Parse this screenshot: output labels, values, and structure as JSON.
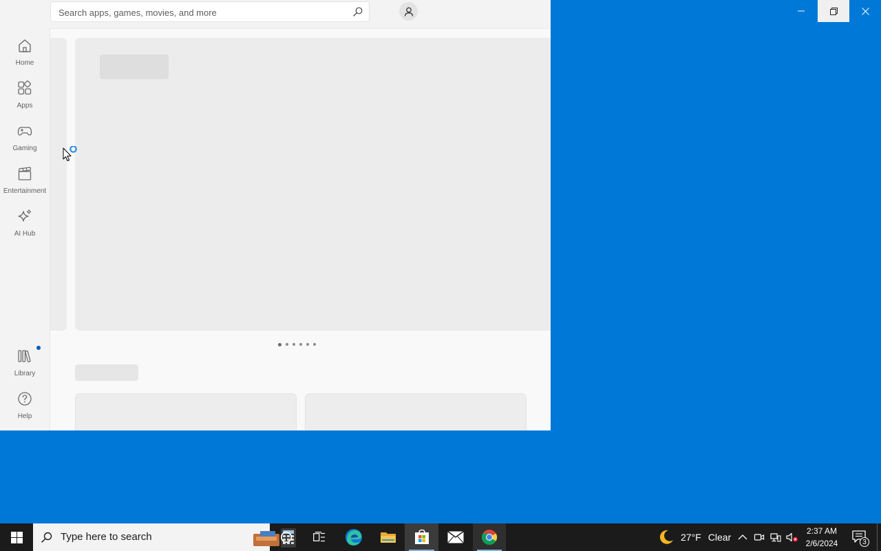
{
  "window_controls": {
    "minimize_icon": "minimize-icon",
    "restore_icon": "restore-icon",
    "close_icon": "close-icon"
  },
  "store": {
    "search": {
      "placeholder": "Search apps, games, movies, and more",
      "value": "",
      "icon": "search-icon"
    },
    "account_icon": "user-icon",
    "nav": {
      "items": [
        {
          "label": "Home",
          "icon": "home-icon"
        },
        {
          "label": "Apps",
          "icon": "apps-icon"
        },
        {
          "label": "Gaming",
          "icon": "gamepad-icon"
        },
        {
          "label": "Entertainment",
          "icon": "clapperboard-icon"
        },
        {
          "label": "AI Hub",
          "icon": "sparkle-icon"
        }
      ],
      "bottom_items": [
        {
          "label": "Library",
          "icon": "library-icon",
          "has_badge": true
        },
        {
          "label": "Help",
          "icon": "help-icon"
        }
      ]
    },
    "hero": {
      "dot_count": 6,
      "active_dot": 0
    },
    "loading": true
  },
  "taskbar": {
    "search_placeholder": "Type here to search",
    "apps": [
      {
        "name": "Cortana",
        "icon": "cortana-icon"
      },
      {
        "name": "Task View",
        "icon": "task-view-icon"
      },
      {
        "name": "Microsoft Edge",
        "icon": "edge-icon"
      },
      {
        "name": "File Explorer",
        "icon": "folder-icon"
      },
      {
        "name": "Microsoft Store",
        "icon": "store-icon",
        "active": true
      },
      {
        "name": "Mail",
        "icon": "mail-icon"
      },
      {
        "name": "Google Chrome",
        "icon": "chrome-icon",
        "active": true
      }
    ],
    "weather": {
      "temp": "27°F",
      "condition": "Clear",
      "icon": "moon-icon"
    },
    "time": "2:37 AM",
    "date": "2/6/2024",
    "notifications_count": "3"
  },
  "colors": {
    "desktop": "#0078d7",
    "taskbar": "#1b1b1b",
    "accent": "#005fb8"
  }
}
